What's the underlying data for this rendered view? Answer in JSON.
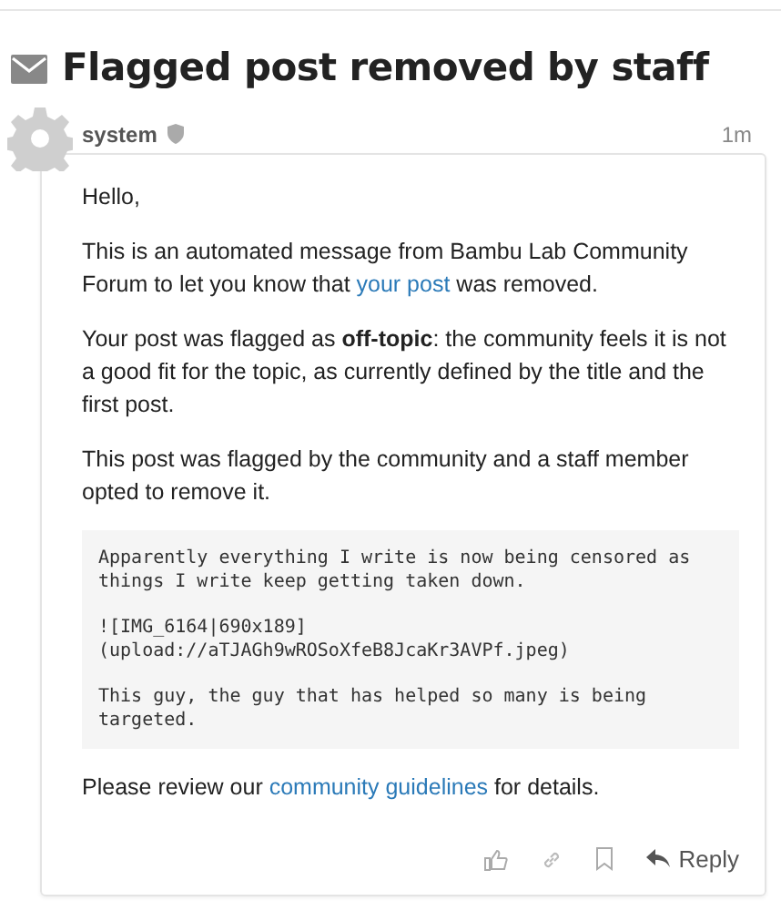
{
  "title": "Flagged post removed by staff",
  "post": {
    "username": "system",
    "time": "1m",
    "greeting": "Hello,",
    "intro": {
      "before": "This is an automated message from Bambu Lab Community Forum to let you know that ",
      "link": "your post",
      "after": " was removed."
    },
    "reason": "Your post was flagged as **off-topic**: the community feels it is not a good fit for the topic, as currently defined by the title and the first post.",
    "note": "This post was flagged by the community and a staff member opted to remove it.",
    "quote": [
      "Apparently everything I write is now being censored as things I write keep getting taken down.",
      "![IMG_6164|690x189]\n(upload://aTJAGh9wROSoXfeB8JcaKr3AVPf.jpeg)",
      "This guy, the guy that has helped so many is being targeted."
    ],
    "closing": {
      "before": "Please review our ",
      "link": "community guidelines",
      "after": " for details."
    },
    "reply_label": "Reply"
  }
}
